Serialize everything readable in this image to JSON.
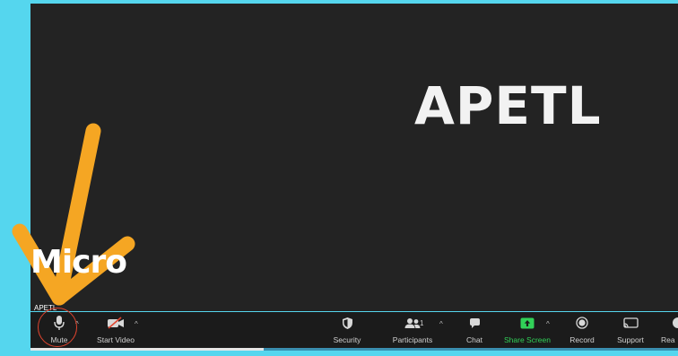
{
  "meeting": {
    "speaker_name": "APETL",
    "participant_tag": "APETL"
  },
  "annotation": {
    "label": "Micro",
    "arrow_color": "#f5a623",
    "circle_color": "#e0442e"
  },
  "toolbar": {
    "mute_label": "Mute",
    "start_video_label": "Start Video",
    "security_label": "Security",
    "participants_label": "Participants",
    "participants_count": "1",
    "chat_label": "Chat",
    "share_label": "Share Screen",
    "record_label": "Record",
    "support_label": "Support",
    "reactions_label": "Rea",
    "caret": "^"
  },
  "colors": {
    "frame_background": "#55d6ee",
    "video_background": "#232323",
    "toolbar_background": "#1b1b1b",
    "share_accent": "#31d158"
  },
  "icons": [
    "microphone-icon",
    "video-off-icon",
    "shield-icon",
    "participants-icon",
    "chat-icon",
    "share-screen-icon",
    "record-icon",
    "support-icon"
  ],
  "progress": {
    "fraction": 0.36
  }
}
